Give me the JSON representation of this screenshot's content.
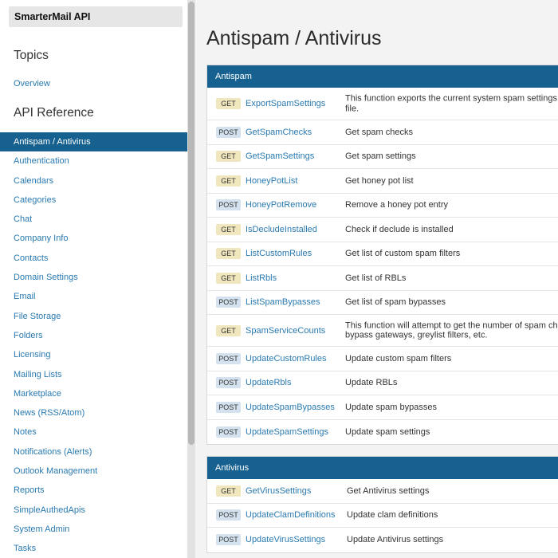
{
  "sidebar": {
    "brand": "SmarterMail API",
    "topics_heading": "Topics",
    "overview_link": "Overview",
    "api_heading": "API Reference",
    "items": [
      {
        "label": "Antispam / Antivirus",
        "active": true
      },
      {
        "label": "Authentication"
      },
      {
        "label": "Calendars"
      },
      {
        "label": "Categories"
      },
      {
        "label": "Chat"
      },
      {
        "label": "Company Info"
      },
      {
        "label": "Contacts"
      },
      {
        "label": "Domain Settings"
      },
      {
        "label": "Email"
      },
      {
        "label": "File Storage"
      },
      {
        "label": "Folders"
      },
      {
        "label": "Licensing"
      },
      {
        "label": "Mailing Lists"
      },
      {
        "label": "Marketplace"
      },
      {
        "label": "News (RSS/Atom)"
      },
      {
        "label": "Notes"
      },
      {
        "label": "Notifications (Alerts)"
      },
      {
        "label": "Outlook Management"
      },
      {
        "label": "Reports"
      },
      {
        "label": "SimpleAuthedApis"
      },
      {
        "label": "System Admin"
      },
      {
        "label": "Tasks"
      }
    ]
  },
  "main": {
    "title": "Antispam / Antivirus",
    "sections": [
      {
        "heading": "Antispam",
        "rows": [
          {
            "method": "GET",
            "name": "ExportSpamSettings",
            "desc": [
              "This function exports the current system spam settings to",
              "file."
            ]
          },
          {
            "method": "POST",
            "name": "GetSpamChecks",
            "desc": [
              "Get spam checks"
            ]
          },
          {
            "method": "GET",
            "name": "GetSpamSettings",
            "desc": [
              "Get spam settings"
            ]
          },
          {
            "method": "GET",
            "name": "HoneyPotList",
            "desc": [
              "Get honey pot list"
            ]
          },
          {
            "method": "POST",
            "name": "HoneyPotRemove",
            "desc": [
              "Remove a honey pot entry"
            ]
          },
          {
            "method": "GET",
            "name": "IsDecludeInstalled",
            "desc": [
              "Check if declude is installed"
            ]
          },
          {
            "method": "GET",
            "name": "ListCustomRules",
            "desc": [
              "Get list of custom spam filters"
            ]
          },
          {
            "method": "GET",
            "name": "ListRbls",
            "desc": [
              "Get list of RBLs"
            ]
          },
          {
            "method": "POST",
            "name": "ListSpamBypasses",
            "desc": [
              "Get list of spam bypasses"
            ]
          },
          {
            "method": "GET",
            "name": "SpamServiceCounts",
            "desc": [
              "This function will attempt to get the number of spam chec",
              "bypass gateways, greylist filters, etc."
            ]
          },
          {
            "method": "POST",
            "name": "UpdateCustomRules",
            "desc": [
              "Update custom spam filters"
            ]
          },
          {
            "method": "POST",
            "name": "UpdateRbls",
            "desc": [
              "Update RBLs"
            ]
          },
          {
            "method": "POST",
            "name": "UpdateSpamBypasses",
            "desc": [
              "Update spam bypasses"
            ]
          },
          {
            "method": "POST",
            "name": "UpdateSpamSettings",
            "desc": [
              "Update spam settings"
            ]
          }
        ]
      },
      {
        "heading": "Antivirus",
        "rows": [
          {
            "method": "GET",
            "name": "GetVirusSettings",
            "desc": [
              "Get Antivirus settings"
            ]
          },
          {
            "method": "POST",
            "name": "UpdateClamDefinitions",
            "desc": [
              "Update clam definitions"
            ]
          },
          {
            "method": "POST",
            "name": "UpdateVirusSettings",
            "desc": [
              "Update Antivirus settings"
            ]
          }
        ]
      }
    ]
  },
  "colors": {
    "accent": "#16618f",
    "link": "#2a7ab0",
    "get_badge": "#f1e7bf",
    "post_badge": "#d3e2ee"
  }
}
